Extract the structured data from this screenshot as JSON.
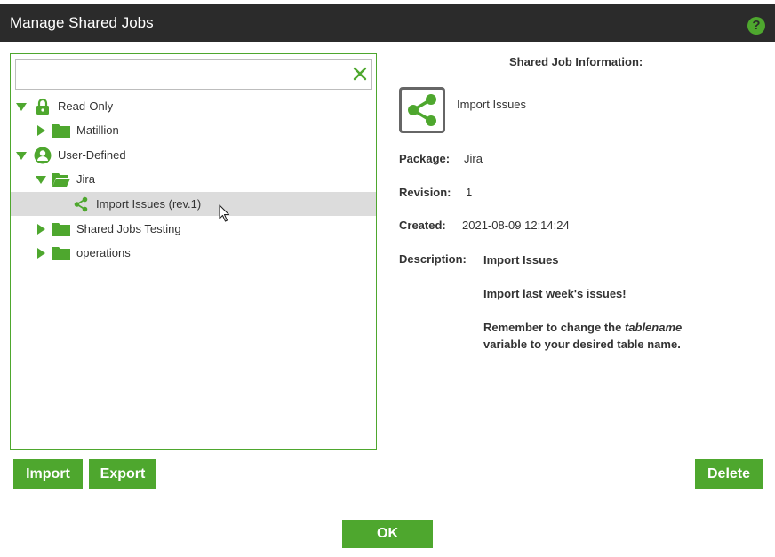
{
  "window": {
    "title": "Manage Shared Jobs"
  },
  "search": {
    "value": "",
    "placeholder": ""
  },
  "tree": {
    "items": [
      {
        "label": "Read-Only",
        "expanded": true,
        "icon": "lock-icon"
      },
      {
        "label": "Matillion",
        "expanded": false,
        "icon": "folder-icon"
      },
      {
        "label": "User-Defined",
        "expanded": true,
        "icon": "user-icon"
      },
      {
        "label": "Jira",
        "expanded": true,
        "icon": "folder-open-icon"
      },
      {
        "label": "Import Issues (rev.1)",
        "selected": true,
        "icon": "share-icon"
      },
      {
        "label": "Shared Jobs Testing",
        "expanded": false,
        "icon": "folder-icon"
      },
      {
        "label": "operations",
        "expanded": false,
        "icon": "folder-icon"
      }
    ]
  },
  "info": {
    "heading": "Shared Job Information:",
    "job_name": "Import Issues",
    "package_label": "Package:",
    "package_value": "Jira",
    "revision_label": "Revision:",
    "revision_value": "1",
    "created_label": "Created:",
    "created_value": "2021-08-09 12:14:24",
    "description_label": "Description:",
    "description_line1": "Import Issues",
    "description_line2": "Import last week's issues!",
    "description_line3_pre": "Remember to change the ",
    "description_line3_em": "tablename",
    "description_line4": "variable to your desired table name."
  },
  "buttons": {
    "import": "Import",
    "export": "Export",
    "delete": "Delete",
    "ok": "OK"
  },
  "colors": {
    "accent": "#4ea72e",
    "titlebar": "#2b2b2b",
    "selected_row": "#dcdcdc"
  }
}
